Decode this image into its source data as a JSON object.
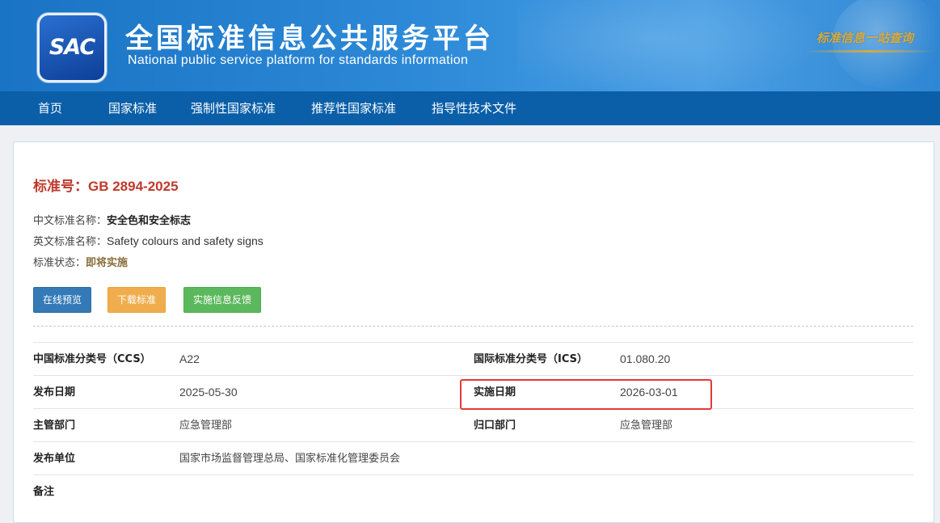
{
  "header": {
    "logo_text": "SAC",
    "title": "全国标准信息公共服务平台",
    "subtitle": "National public service platform  for standards information",
    "slogan": "标准信息一站查询"
  },
  "nav": {
    "items": [
      "首页",
      "国家标准",
      "强制性国家标准",
      "推荐性国家标准",
      "指导性技术文件"
    ]
  },
  "standard": {
    "number_label": "标准号：",
    "number": "GB 2894-2025",
    "cn_name_label": "中文标准名称：",
    "cn_name": "安全色和安全标志",
    "en_name_label": "英文标准名称：",
    "en_name": "Safety colours and safety signs",
    "status_label": "标准状态：",
    "status": "即将实施"
  },
  "buttons": {
    "preview": "在线预览",
    "download": "下载标准",
    "feedback": "实施信息反馈"
  },
  "details": {
    "ccs_label": "中国标准分类号（CCS）",
    "ccs_value": "A22",
    "ics_label": "国际标准分类号（ICS）",
    "ics_value": "01.080.20",
    "publish_date_label": "发布日期",
    "publish_date": "2025-05-30",
    "impl_date_label": "实施日期",
    "impl_date": "2026-03-01",
    "dept_label": "主管部门",
    "dept_value": "应急管理部",
    "owner_label": "归口部门",
    "owner_value": "应急管理部",
    "issuer_label": "发布单位",
    "issuer_value": "国家市场监督管理总局、国家标准化管理委员会",
    "remark_label": "备注",
    "remark_value": ""
  },
  "colors": {
    "banner": "#1a73c4",
    "nav": "#0a5fa8",
    "title_red": "#c0392b",
    "highlight": "#e53935"
  }
}
